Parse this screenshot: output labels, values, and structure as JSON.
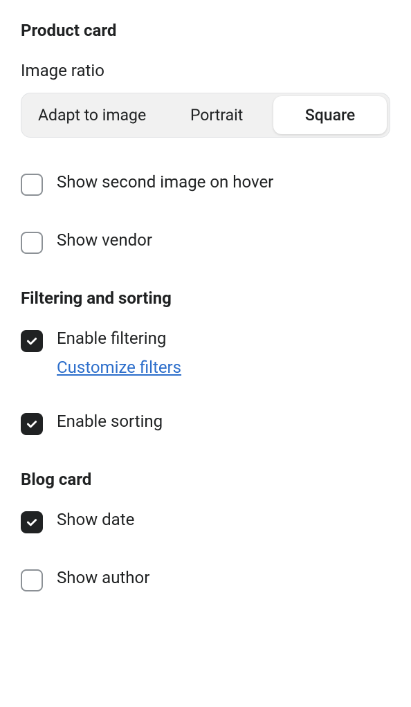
{
  "productCard": {
    "title": "Product card",
    "imageRatio": {
      "label": "Image ratio",
      "options": [
        "Adapt to image",
        "Portrait",
        "Square"
      ],
      "selected": "Square"
    },
    "showSecondImage": {
      "label": "Show second image on hover",
      "checked": false
    },
    "showVendor": {
      "label": "Show vendor",
      "checked": false
    }
  },
  "filtering": {
    "title": "Filtering and sorting",
    "enableFiltering": {
      "label": "Enable filtering",
      "checked": true,
      "link": "Customize filters"
    },
    "enableSorting": {
      "label": "Enable sorting",
      "checked": true
    }
  },
  "blogCard": {
    "title": "Blog card",
    "showDate": {
      "label": "Show date",
      "checked": true
    },
    "showAuthor": {
      "label": "Show author",
      "checked": false
    }
  }
}
